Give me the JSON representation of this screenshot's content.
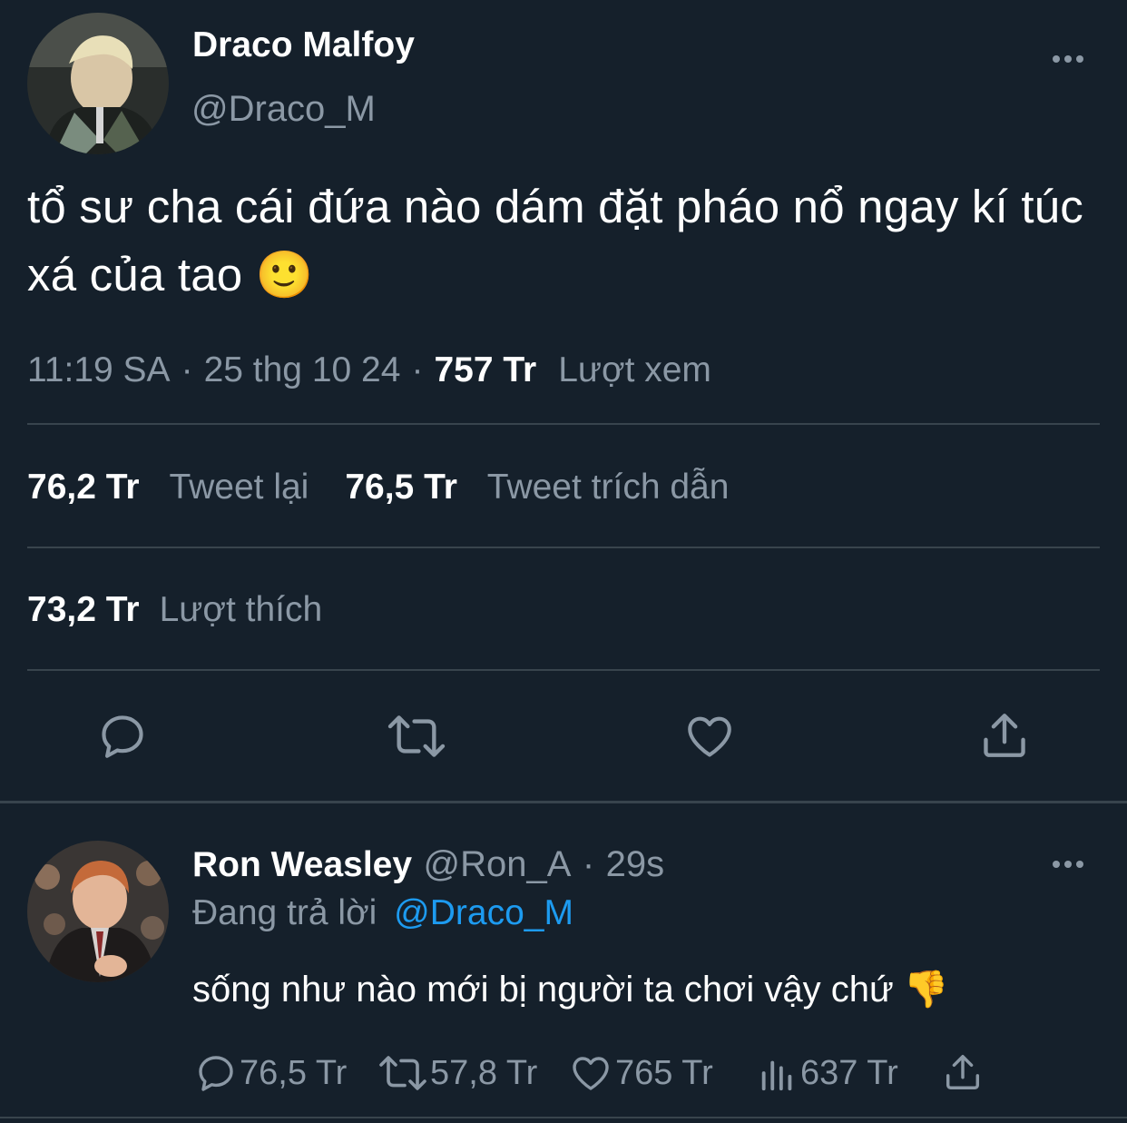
{
  "main_tweet": {
    "author_name": "Draco Malfoy",
    "author_handle": "@Draco_M",
    "text": "tổ sư cha cái đứa nào dám đặt pháo nổ ngay kí túc xá của tao 🙂",
    "time": "11:19 SA",
    "date": "25 thg 10 24",
    "sep": "·",
    "views_count": "757 Tr",
    "views_label": "Lượt xem",
    "retweets_count": "76,2 Tr",
    "retweets_label": "Tweet lại",
    "quotes_count": "76,5 Tr",
    "quotes_label": "Tweet trích dẫn",
    "likes_count": "73,2 Tr",
    "likes_label": "Lượt thích"
  },
  "reply_tweet": {
    "author_name": "Ron Weasley",
    "author_handle": "@Ron_A",
    "sep": "·",
    "time_ago": "29s",
    "replying_to_label": "Đang trả lời",
    "replying_to_handle": "@Draco_M",
    "text": "sống như nào mới bị người ta chơi vậy chứ 👎",
    "reply_count": "76,5 Tr",
    "retweet_count": "57,8 Tr",
    "like_count": "765 Tr",
    "view_count": "637 Tr"
  },
  "icons": {
    "more": "more-horizontal-icon",
    "reply": "reply-icon",
    "retweet": "retweet-icon",
    "like": "heart-icon",
    "share": "share-icon",
    "views": "views-icon"
  },
  "colors": {
    "background": "#15202b",
    "text": "#ffffff",
    "muted": "#8b98a5",
    "link": "#1d9bf0",
    "divider": "#38444d"
  }
}
